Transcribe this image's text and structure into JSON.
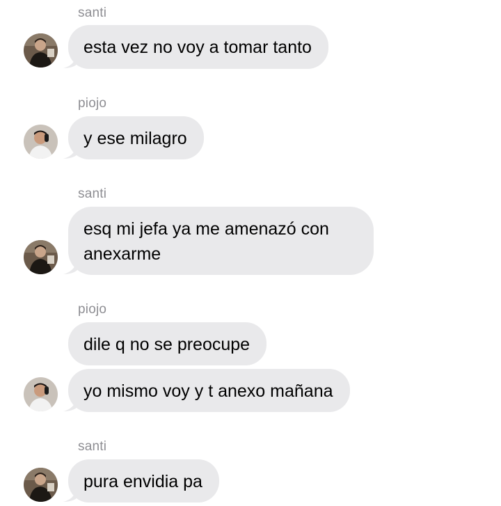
{
  "messages": [
    {
      "sender": "santi",
      "avatar_icon": "santi-avatar",
      "bubbles": [
        "esta vez no voy a tomar tanto"
      ]
    },
    {
      "sender": "piojo",
      "avatar_icon": "piojo-avatar",
      "bubbles": [
        "y ese milagro"
      ]
    },
    {
      "sender": "santi",
      "avatar_icon": "santi-avatar",
      "bubbles": [
        "esq mi jefa ya me amenazó con anexarme"
      ]
    },
    {
      "sender": "piojo",
      "avatar_icon": "piojo-avatar",
      "bubbles": [
        "dile q no se preocupe",
        "yo mismo voy y t anexo mañana"
      ]
    },
    {
      "sender": "santi",
      "avatar_icon": "santi-avatar",
      "bubbles": [
        "pura envidia pa"
      ]
    }
  ],
  "colors": {
    "bubble_background": "#e9e9eb",
    "sender_label": "#8e8e93",
    "message_text": "#000000",
    "background": "#ffffff"
  }
}
